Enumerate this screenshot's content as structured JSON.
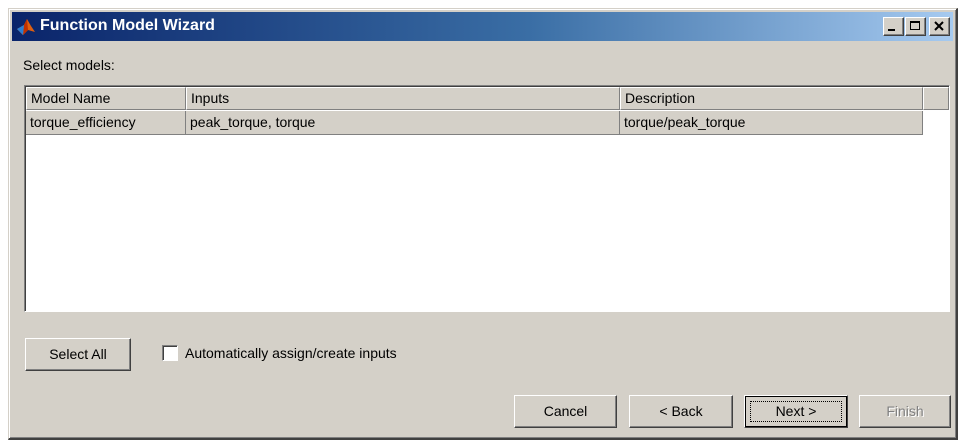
{
  "window": {
    "title": "Function Model Wizard",
    "icon": "matlab-membrane-icon",
    "controls": {
      "minimize": "minimize-icon",
      "maximize": "maximize-icon",
      "close": "close-icon"
    }
  },
  "main": {
    "select_label": "Select models:",
    "table": {
      "columns": [
        "Model Name",
        "Inputs",
        "Description",
        ""
      ],
      "rows": [
        {
          "model_name": "torque_efficiency",
          "inputs": "peak_torque, torque",
          "description": "torque/peak_torque",
          "selected": true
        }
      ]
    },
    "select_all_label": "Select All",
    "auto_assign": {
      "label": "Automatically assign/create inputs",
      "checked": false
    }
  },
  "footer": {
    "cancel_label": "Cancel",
    "back_label": "< Back",
    "next_label": "Next >",
    "finish_label": "Finish"
  },
  "colors": {
    "title_gradient_start": "#0a246a",
    "title_gradient_end": "#a6caf0",
    "face": "#d4d0c8",
    "disabled_text": "#808080"
  }
}
